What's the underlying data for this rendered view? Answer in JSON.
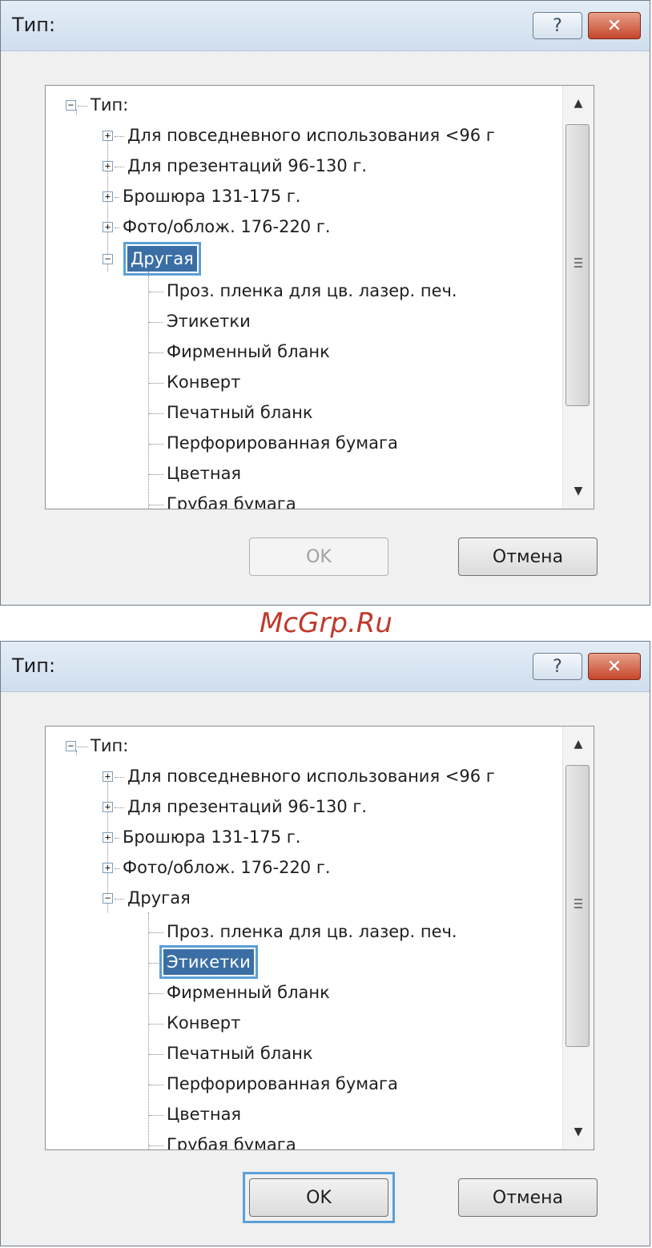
{
  "watermark": "McGrp.Ru",
  "dialogs": [
    {
      "title": "Тип:",
      "help_glyph": "?",
      "close_glyph": "✕",
      "tree": {
        "root": "Тип:",
        "children": [
          {
            "label": "Для повседневного использования <96 г",
            "expander": "+"
          },
          {
            "label": "Для презентаций 96-130 г.",
            "expander": "+"
          },
          {
            "label": "Брошюра 131-175 г.",
            "expander": "+"
          },
          {
            "label": "Фото/облож. 176-220 г.",
            "expander": "+"
          },
          {
            "label": "Другая",
            "expander": "−",
            "selected": true
          }
        ],
        "subitems": [
          {
            "label": "Проз. пленка для цв. лазер. печ."
          },
          {
            "label": "Этикетки"
          },
          {
            "label": "Фирменный бланк"
          },
          {
            "label": "Конверт"
          },
          {
            "label": "Печатный бланк"
          },
          {
            "label": "Перфорированная бумага"
          },
          {
            "label": "Цветная"
          },
          {
            "label": "Грубая бумага"
          }
        ]
      },
      "ok_label": "OK",
      "ok_enabled": false,
      "cancel_label": "Отмена"
    },
    {
      "title": "Тип:",
      "help_glyph": "?",
      "close_glyph": "✕",
      "tree": {
        "root": "Тип:",
        "children": [
          {
            "label": "Для повседневного использования <96 г",
            "expander": "+"
          },
          {
            "label": "Для презентаций 96-130 г.",
            "expander": "+"
          },
          {
            "label": "Брошюра 131-175 г.",
            "expander": "+"
          },
          {
            "label": "Фото/облож. 176-220 г.",
            "expander": "+"
          },
          {
            "label": "Другая",
            "expander": "−"
          }
        ],
        "subitems": [
          {
            "label": "Проз. пленка для цв. лазер. печ."
          },
          {
            "label": "Этикетки",
            "selected": true
          },
          {
            "label": "Фирменный бланк"
          },
          {
            "label": "Конверт"
          },
          {
            "label": "Печатный бланк"
          },
          {
            "label": "Перфорированная бумага"
          },
          {
            "label": "Цветная"
          },
          {
            "label": "Грубая бумага"
          }
        ]
      },
      "ok_label": "OK",
      "ok_enabled": true,
      "cancel_label": "Отмена"
    }
  ]
}
